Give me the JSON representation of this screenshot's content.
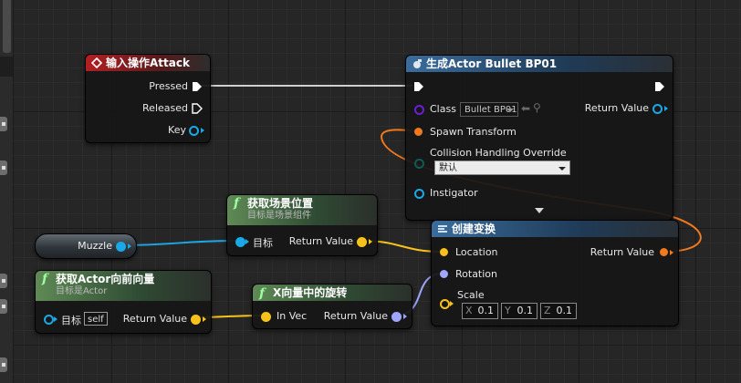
{
  "colors": {
    "exec": "#ffffff",
    "object_blue": "#1aa8e6",
    "vector_yellow": "#f7c31a",
    "transform_orange": "#f17a1f",
    "rotator_violet": "#9ea6ff",
    "class_purple": "#6a1fd4",
    "enum_teal": "#0e5c55"
  },
  "nodes": {
    "input_action": {
      "title": "输入操作Attack",
      "icon": "input-action-icon",
      "pins": {
        "pressed": "Pressed",
        "released": "Released",
        "key": "Key"
      }
    },
    "spawn_actor": {
      "title": "生成Actor Bullet BP01",
      "icon": "spawn-icon",
      "pins": {
        "class": "Class",
        "class_value": "Bullet BP01",
        "return_value": "Return Value",
        "spawn_transform": "Spawn Transform",
        "collision": "Collision Handling Override",
        "collision_value": "默认",
        "instigator": "Instigator"
      }
    },
    "get_world_location": {
      "title": "获取场景位置",
      "subtitle": "目标是场景组件",
      "pins": {
        "target": "目标",
        "return_value": "Return Value"
      }
    },
    "muzzle": {
      "label": "Muzzle"
    },
    "get_forward_vector": {
      "title": "获取Actor向前向量",
      "subtitle": "目标是Actor",
      "pins": {
        "target": "目标",
        "target_value": "self",
        "return_value": "Return Value"
      }
    },
    "rotation_from_x": {
      "title": "X向量中的旋转",
      "pins": {
        "in_vec": "In Vec",
        "return_value": "Return Value"
      }
    },
    "make_transform": {
      "title": "创建变换",
      "icon": "make-struct-icon",
      "pins": {
        "location": "Location",
        "rotation": "Rotation",
        "scale": "Scale",
        "return_value": "Return Value",
        "scale_x_label": "X",
        "scale_x": "0.1",
        "scale_y_label": "Y",
        "scale_y": "0.1",
        "scale_z_label": "Z",
        "scale_z": "0.1"
      }
    }
  }
}
